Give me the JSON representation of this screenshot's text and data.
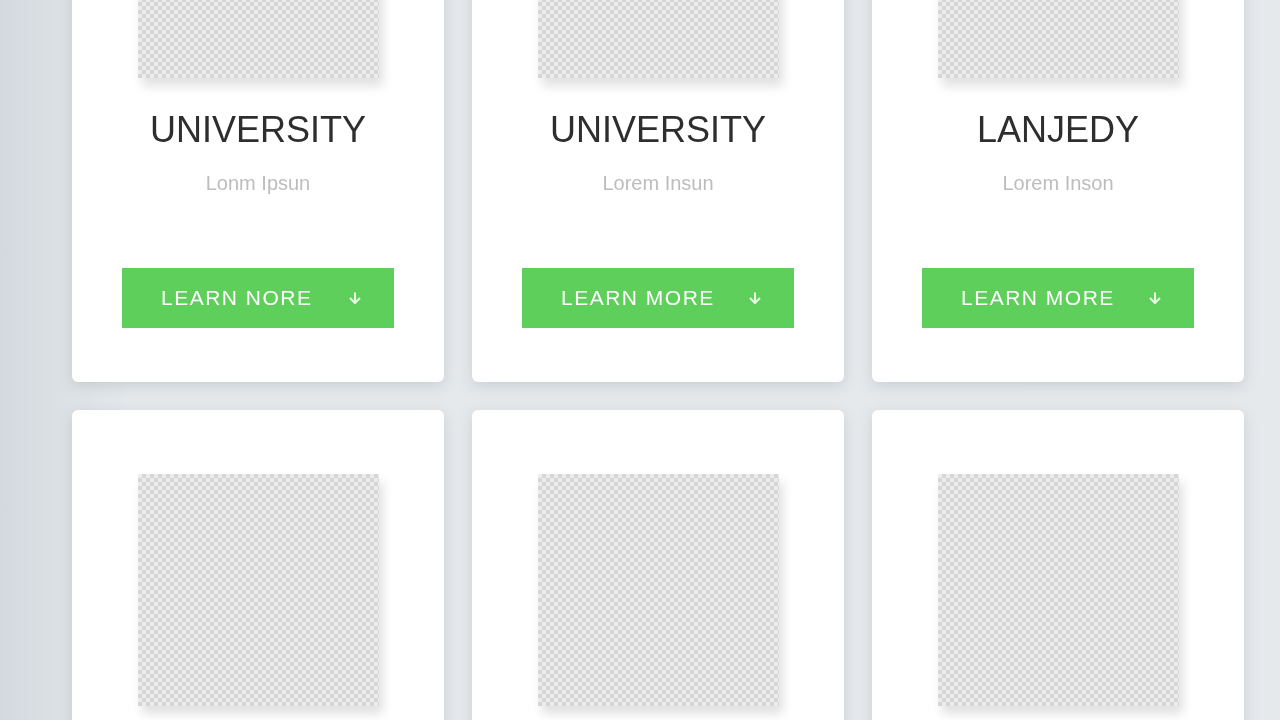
{
  "cards": [
    {
      "photo": true,
      "title": "UNIVERSITY",
      "subtitle": "Lonm Ipsun",
      "button": {
        "label": "LEARN NORE"
      }
    },
    {
      "photo": true,
      "title": "UNIVERSITY",
      "subtitle": "Lorem Insun",
      "button": {
        "label": "LEARN MORE"
      }
    },
    {
      "photo": true,
      "title": "LANJEDY",
      "subtitle": "Lorem Inson",
      "button": {
        "label": "LEARN MORE"
      }
    },
    {
      "photo": true
    },
    {
      "photo": true
    },
    {
      "photo": true
    }
  ]
}
